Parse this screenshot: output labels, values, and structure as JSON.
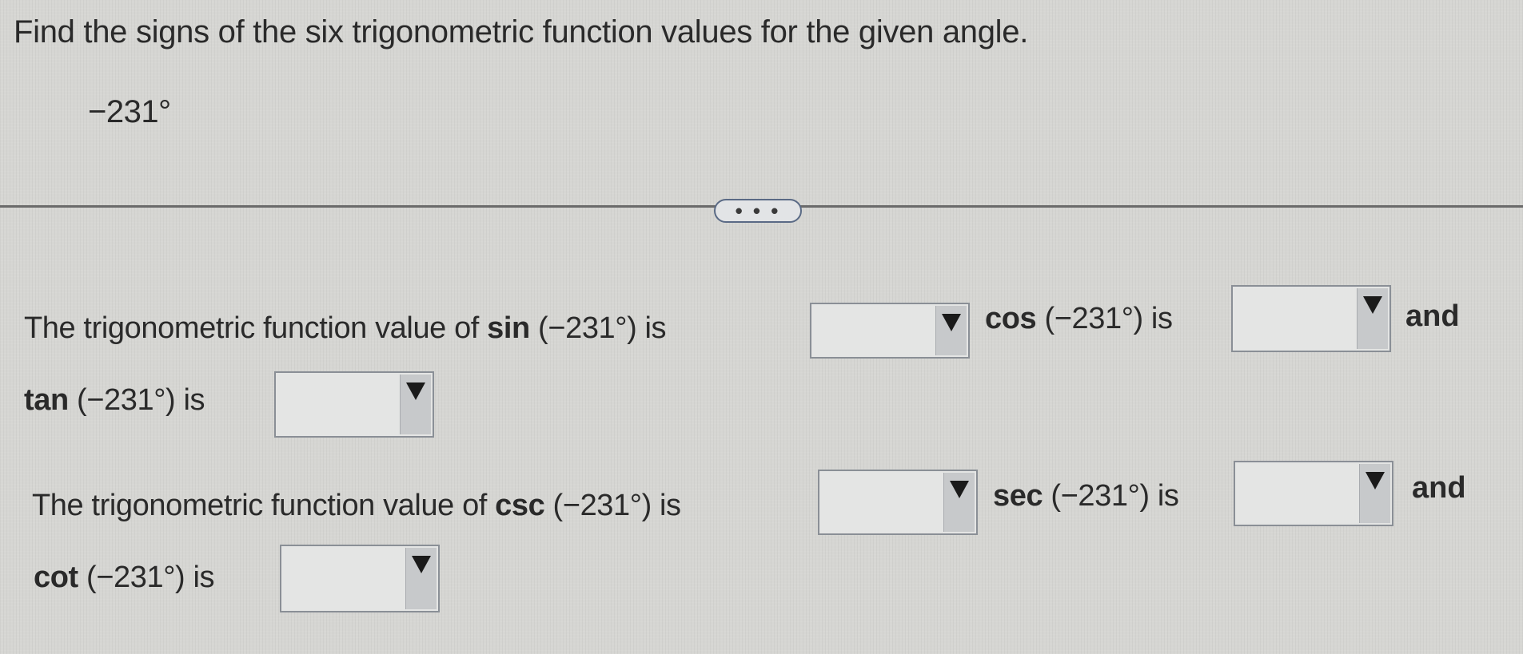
{
  "header": {
    "instruction": "Find the signs of the six trigonometric function values for the given angle.",
    "angle": "−231°"
  },
  "more_button": {
    "label": "• • •"
  },
  "question1": {
    "prefix": "The trigonometric function value of",
    "sin_fn": "sin",
    "sin_arg": "(−231°) is",
    "cos_fn": "cos",
    "cos_arg": "(−231°) is",
    "and": "and",
    "tan_fn": "tan",
    "tan_arg": "(−231°) is"
  },
  "question2": {
    "prefix": "The trigonometric function value of",
    "csc_fn": "csc",
    "csc_arg": "(−231°) is",
    "sec_fn": "sec",
    "sec_arg": "(−231°) is",
    "and": "and",
    "cot_fn": "cot",
    "cot_arg": "(−231°) is"
  },
  "dropdowns": {
    "sin_value": "",
    "cos_value": "",
    "tan_value": "",
    "csc_value": "",
    "sec_value": "",
    "cot_value": ""
  }
}
